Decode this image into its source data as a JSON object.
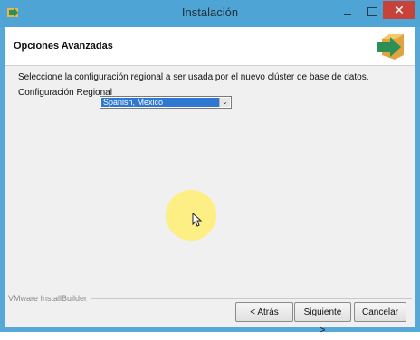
{
  "window": {
    "title": "Instalación",
    "close_glyph": "✕"
  },
  "header": {
    "title": "Opciones Avanzadas",
    "logo_icon": "installer-arrow-icon"
  },
  "main": {
    "instruction": "Seleccione la configuración regional a ser usada por el nuevo clúster de base de datos.",
    "locale_label": "Configuración Regional",
    "locale_value": "Spanish, Mexico",
    "dropdown_glyph": "⌄"
  },
  "footer": {
    "vendor": "VMware InstallBuilder",
    "back_label": "< Atrás",
    "next_label": "Siguiente >",
    "cancel_label": "Cancelar"
  },
  "colors": {
    "titlebar": "#4fa4d6",
    "close": "#c7433a",
    "selection": "#2f78d0",
    "logo_green": "#2d8f53",
    "logo_orange": "#e0a341"
  }
}
